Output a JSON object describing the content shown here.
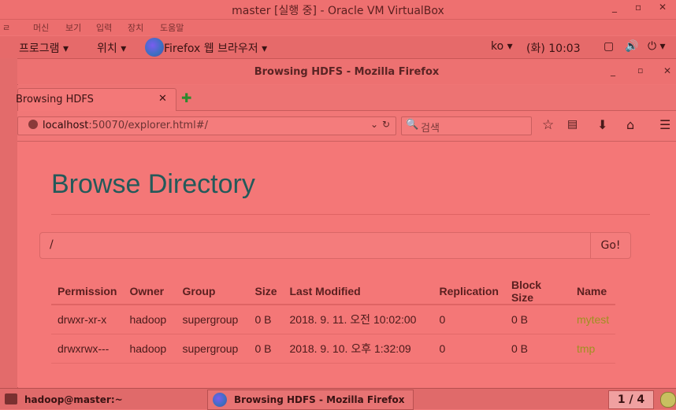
{
  "vbox": {
    "title": "master [실행 중] - Oracle VM VirtualBox",
    "menu": [
      "머신",
      "보기",
      "입력",
      "장치",
      "도움말"
    ]
  },
  "gnome": {
    "apps_label": "프로그램",
    "places_label": "위치",
    "active_app": "Firefox 웹 브라우저",
    "lang": "ko",
    "clock": "(화) 10:03"
  },
  "firefox": {
    "window_title": "Browsing HDFS - Mozilla Firefox",
    "tab_title": "Browsing HDFS",
    "url_host": "localhost",
    "url_rest": ":50070/explorer.html#/",
    "search_placeholder": "검색"
  },
  "page": {
    "heading": "Browse Directory",
    "path_value": "/",
    "go_label": "Go!",
    "columns": [
      "Permission",
      "Owner",
      "Group",
      "Size",
      "Last Modified",
      "Replication",
      "Block Size",
      "Name"
    ],
    "rows": [
      {
        "permission": "drwxr-xr-x",
        "owner": "hadoop",
        "group": "supergroup",
        "size": "0 B",
        "modified": "2018. 9. 11. 오전 10:02:00",
        "replication": "0",
        "block_size": "0 B",
        "name": "mytest"
      },
      {
        "permission": "drwxrwx---",
        "owner": "hadoop",
        "group": "supergroup",
        "size": "0 B",
        "modified": "2018. 9. 10. 오후 1:32:09",
        "replication": "0",
        "block_size": "0 B",
        "name": "tmp"
      }
    ]
  },
  "taskbar": {
    "terminal_label": "hadoop@master:~",
    "firefox_label": "Browsing HDFS - Mozilla Firefox",
    "workspace": "1 / 4"
  },
  "colors": {
    "heading": "#245a5a",
    "link": "#a09020",
    "overlay": "#ef7575"
  }
}
